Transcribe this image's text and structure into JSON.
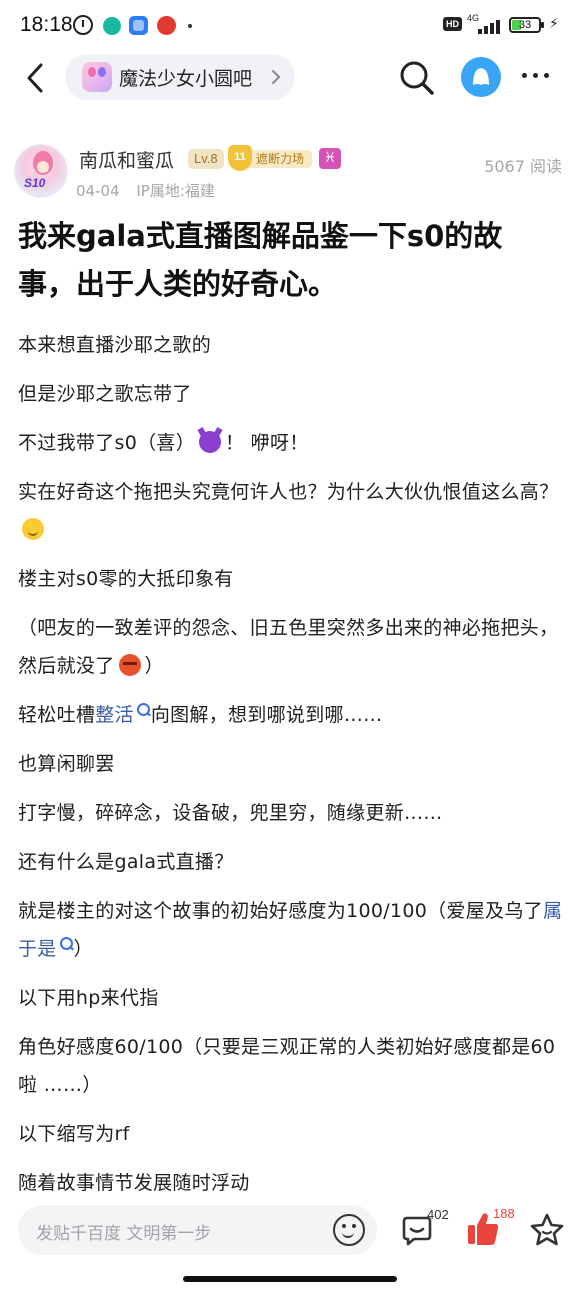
{
  "status_bar": {
    "time": "18:18",
    "network": "4G",
    "hd": "HD",
    "battery": "33"
  },
  "header": {
    "forum_name": "魔法少女小圆吧"
  },
  "author": {
    "name": "南瓜和蜜瓜",
    "level": "Lv.8",
    "title_badge_num": "11",
    "title_badge": "遮断力场",
    "zodiac": "♓",
    "s10_badge": "S10",
    "date": "04-04",
    "ip": "IP属地:福建",
    "read_count": "5067 阅读"
  },
  "post": {
    "title": "我来gala式直播图解品鉴一下s0的故事，出于人类的好奇心。",
    "paragraphs": {
      "p1": "本来想直播沙耶之歌的",
      "p2": "但是沙耶之歌忘带了",
      "p3a": "不过我带了s0（喜）",
      "p3b": "！ 咿呀！",
      "p4": "实在好奇这个拖把头究竟何许人也？为什么大伙仇恨值这么高？",
      "p5": "楼主对s0零的大抵印象有",
      "p6": "（吧友的一致差评的怨念、旧五色里突然多出来的神必拖把头，然后就没了",
      "p6_end": "）",
      "p7a": "轻松吐槽",
      "p7_link": "整活",
      "p7b": "向图解，想到哪说到哪……",
      "p8": "也算闲聊罢",
      "p9": "打字慢，碎碎念，设备破，兜里穷，随缘更新……",
      "p10": "还有什么是gala式直播？",
      "p11a": "就是楼主的对这个故事的初始好感度为100/100（爱屋及乌了",
      "p11_link": "属于是",
      "p11b": "）",
      "p12": "以下用hp来代指",
      "p13": "角色好感度60/100（只要是三观正常的人类初始好感度都是60啦 ……）",
      "p14": "以下缩写为rf",
      "p15": "随着故事情节发展随时浮动"
    }
  },
  "bottom_bar": {
    "reply_placeholder": "发贴千百度 文明第一步",
    "comment_count": "402",
    "like_count": "188"
  },
  "colors": {
    "link": "#3a5da8",
    "like": "#e8453c",
    "profile": "#3aa5f5"
  }
}
